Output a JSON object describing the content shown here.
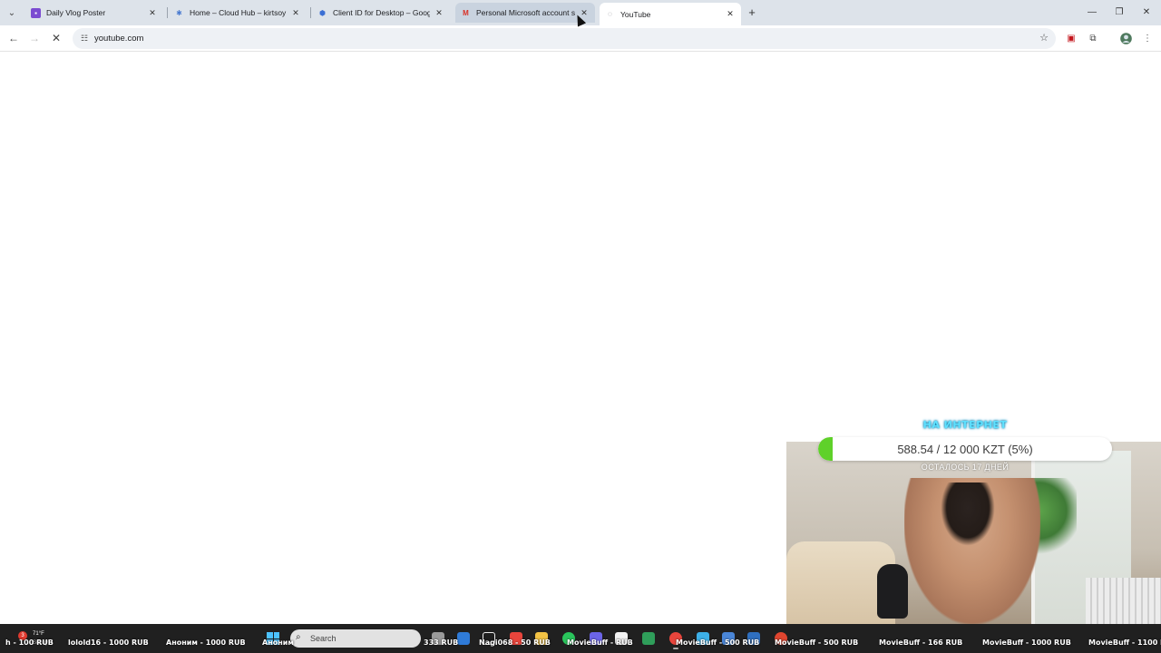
{
  "browser": {
    "tabs": [
      {
        "title": "Daily Vlog Poster",
        "favicon": "purple-calendar-icon",
        "color": "#7b4bd1"
      },
      {
        "title": "Home – Cloud Hub – kirtsoy au",
        "favicon": "cloud-hub-icon",
        "color": "#4a7bd0"
      },
      {
        "title": "Client ID for Desktop – Google",
        "favicon": "shield-icon",
        "color": "#3b6fd4"
      },
      {
        "title": "Personal Microsoft account se",
        "favicon": "gmail-icon",
        "color": "#d93025"
      },
      {
        "title": "YouTube",
        "favicon": "loading-icon",
        "color": "#5f6368"
      }
    ],
    "address": {
      "url": "youtube.com"
    }
  },
  "overlay": {
    "title": "НА ИНТЕРНЕТ",
    "progress_text": "588.54 / 12 000 KZT (5%)",
    "progress_fraction": 0.05,
    "remaining_text": "ОСТАЛОСЬ 17 ДНЕЙ",
    "fill_color": "#5fd12a"
  },
  "ticker": {
    "items": [
      "h - 100 RUB",
      "lolold16 - 1000 RUB",
      "Аноним - 1000 RUB",
      "Аноним",
      "333 RUB",
      "Nagi068 - 50 RUB",
      "MovieBuff - RUB",
      "MovieBuff - 500 RUB",
      "MovieBuff - 500 RUB",
      "MovieBuff - 166 RUB",
      "MovieBuff - 1000 RUB",
      "MovieBuff - 1100 RUB"
    ]
  },
  "taskbar": {
    "weather_temp": "71°F",
    "weather_cond": "Sunny",
    "notif_count": "3",
    "search_placeholder": "Search"
  }
}
